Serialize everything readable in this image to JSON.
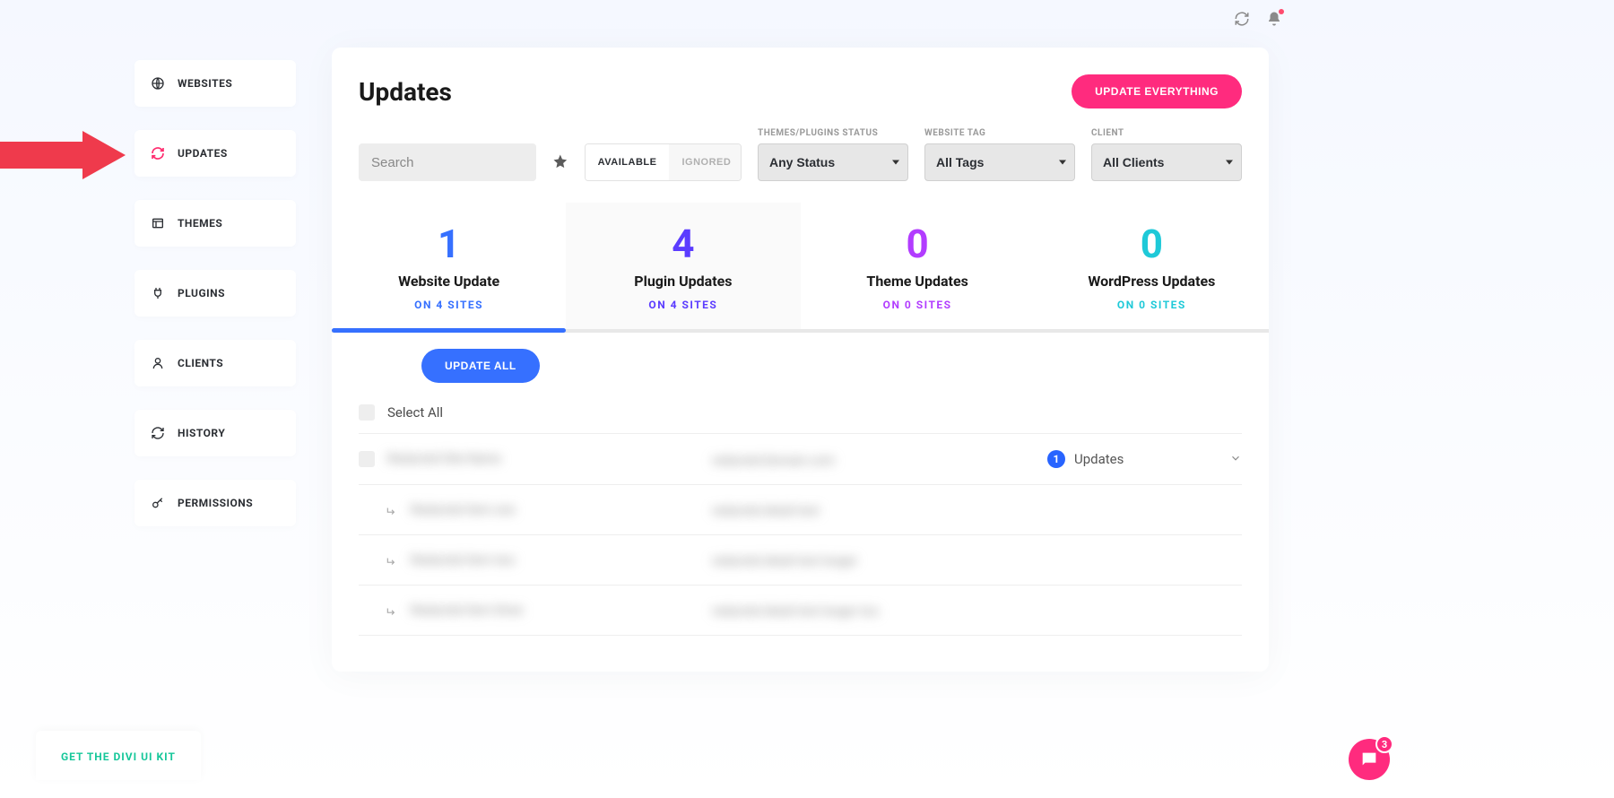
{
  "header": {
    "refresh_icon": "refresh",
    "notifications_icon": "bell"
  },
  "sidebar": {
    "items": [
      {
        "label": "WEBSITES",
        "icon": "globe"
      },
      {
        "label": "UPDATES",
        "icon": "refresh",
        "active": true
      },
      {
        "label": "THEMES",
        "icon": "layout"
      },
      {
        "label": "PLUGINS",
        "icon": "plug"
      },
      {
        "label": "CLIENTS",
        "icon": "user"
      },
      {
        "label": "HISTORY",
        "icon": "refresh"
      },
      {
        "label": "PERMISSIONS",
        "icon": "key"
      }
    ]
  },
  "page": {
    "title": "Updates",
    "update_everything_label": "UPDATE EVERYTHING"
  },
  "filters": {
    "search_placeholder": "Search",
    "toggle": {
      "available": "AVAILABLE",
      "ignored": "IGNORED"
    },
    "status": {
      "label": "THEMES/PLUGINS STATUS",
      "value": "Any Status"
    },
    "tag": {
      "label": "WEBSITE TAG",
      "value": "All Tags"
    },
    "client": {
      "label": "CLIENT",
      "value": "All Clients"
    }
  },
  "stats": [
    {
      "number": "1",
      "title": "Website Update",
      "sub": "ON 4 SITES",
      "color_num": "#3670ff",
      "color_sub": "#3670ff"
    },
    {
      "number": "4",
      "title": "Plugin Updates",
      "sub": "ON 4 SITES",
      "color_num": "#5b3cff",
      "color_sub": "#5b3cff"
    },
    {
      "number": "0",
      "title": "Theme Updates",
      "sub": "ON 0 SITES",
      "color_num": "#b23cff",
      "color_sub": "#b23cff"
    },
    {
      "number": "0",
      "title": "WordPress Updates",
      "sub": "ON 0 SITES",
      "color_num": "#1ec9d8",
      "color_sub": "#1ec9d8"
    }
  ],
  "actions": {
    "update_all_label": "UPDATE ALL",
    "select_all_label": "Select All"
  },
  "list": {
    "parent": {
      "name": "Redacted Site Name",
      "domain": "redacted-domain.com",
      "badge_count": "1",
      "updates_label": "Updates"
    },
    "children": [
      {
        "name": "Redacted item one",
        "detail": "redacted detail text"
      },
      {
        "name": "Redacted item two",
        "detail": "redacted detail text longer"
      },
      {
        "name": "Redacted item three",
        "detail": "redacted detail text longer too"
      }
    ]
  },
  "promo": {
    "text": "GET THE DIVI UI KIT"
  },
  "chat": {
    "count": "3"
  }
}
